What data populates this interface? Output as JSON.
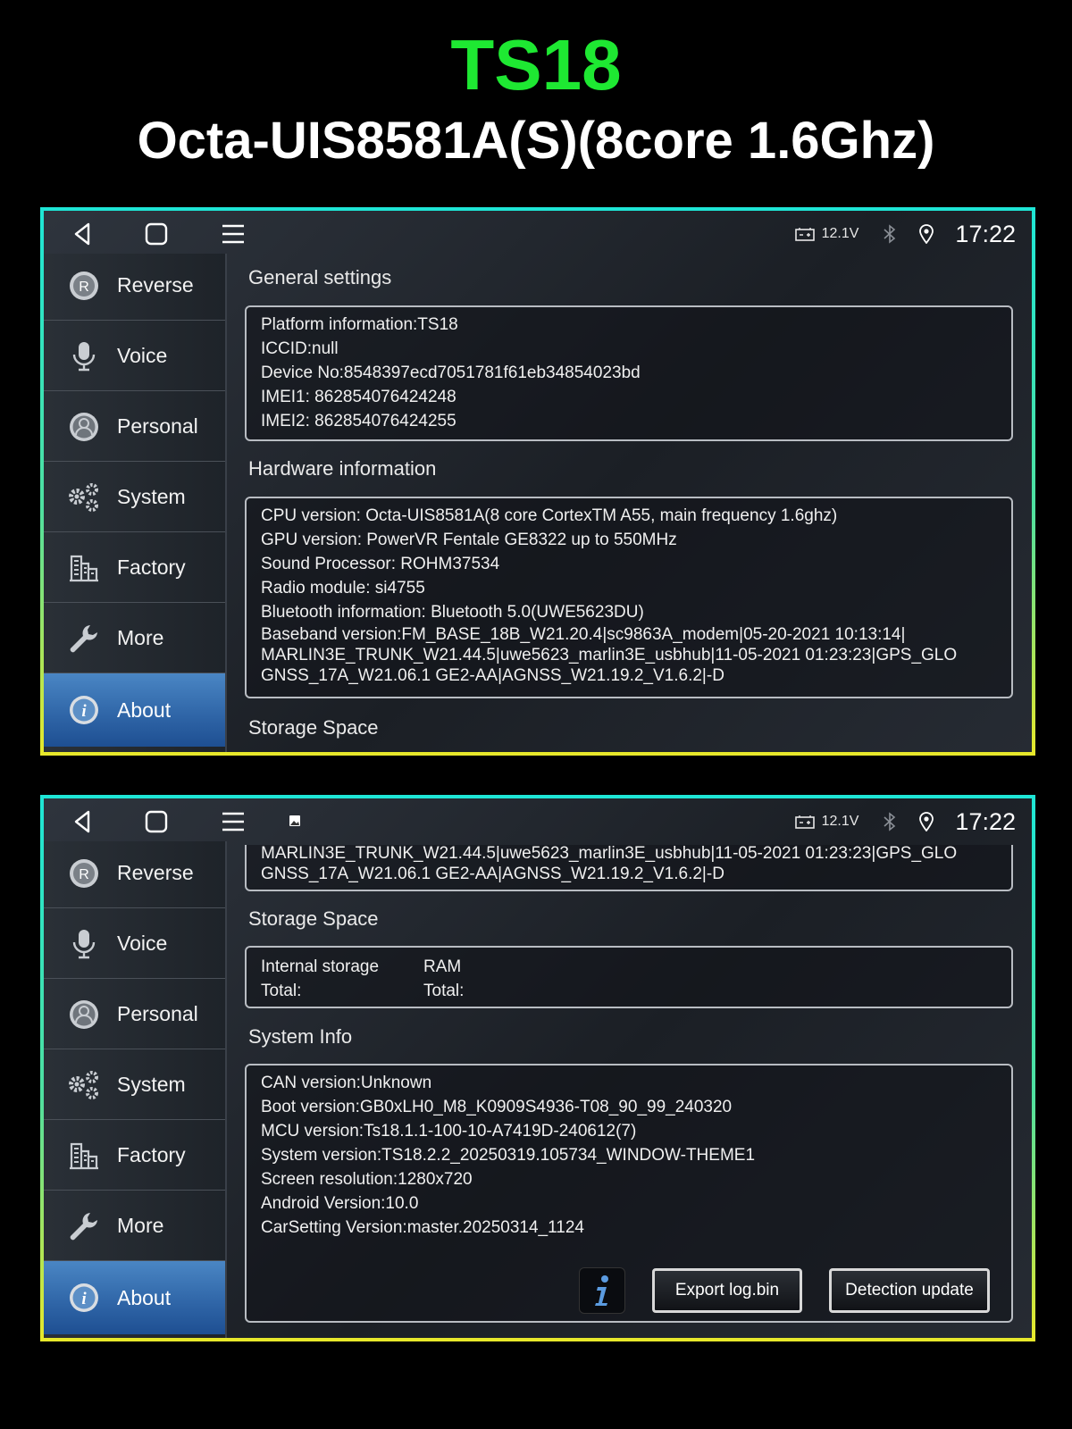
{
  "heading": {
    "model": "TS18",
    "chip": "Octa-UIS8581A(S)(8core 1.6Ghz)"
  },
  "status": {
    "voltage": "12.1V",
    "time": "17:22"
  },
  "sidebar": {
    "items": [
      {
        "label": "Reverse",
        "icon": "reverse-icon"
      },
      {
        "label": "Voice",
        "icon": "microphone-icon"
      },
      {
        "label": "Personal",
        "icon": "person-icon"
      },
      {
        "label": "System",
        "icon": "gears-icon"
      },
      {
        "label": "Factory",
        "icon": "factory-icon"
      },
      {
        "label": "More",
        "icon": "wrench-icon"
      },
      {
        "label": "About",
        "icon": "info-icon",
        "active": true
      }
    ]
  },
  "screen1": {
    "general_title": "General settings",
    "general_lines": [
      "Platform information:TS18",
      "ICCID:null",
      "Device No:8548397ecd7051781f61eb34854023bd",
      "IMEI1:  862854076424248",
      "IMEI2:  862854076424255"
    ],
    "hardware_title": "Hardware information",
    "hardware_lines": [
      "CPU version: Octa-UIS8581A(8 core CortexTM A55, main frequency 1.6ghz)",
      "GPU version: PowerVR Fentale GE8322 up to 550MHz",
      "Sound Processor: ROHM37534",
      "Radio module: si4755",
      "Bluetooth information: Bluetooth 5.0(UWE5623DU)"
    ],
    "baseband_lines": [
      "Baseband version:FM_BASE_18B_W21.20.4|sc9863A_modem|05-20-2021 10:13:14|",
      "MARLIN3E_TRUNK_W21.44.5|uwe5623_marlin3E_usbhub|11-05-2021 01:23:23|GPS_GLO",
      "GNSS_17A_W21.06.1 GE2-AA|AGNSS_W21.19.2_V1.6.2|-D"
    ],
    "storage_title": "Storage Space"
  },
  "screen2": {
    "baseband_tail": [
      "MARLIN3E_TRUNK_W21.44.5|uwe5623_marlin3E_usbhub|11-05-2021 01:23:23|GPS_GLO",
      "GNSS_17A_W21.06.1 GE2-AA|AGNSS_W21.19.2_V1.6.2|-D"
    ],
    "storage_title": "Storage Space",
    "internal_label": "Internal storage",
    "internal_total": "Total:",
    "ram_label": "RAM",
    "ram_total": "Total:",
    "sysinfo_title": "System Info",
    "sysinfo_lines": [
      "CAN version:Unknown",
      "Boot version:GB0xLH0_M8_K0909S4936-T08_90_99_240320",
      "MCU version:Ts18.1.1-100-10-A7419D-240612(7)",
      "System version:TS18.2.2_20250319.105734_WINDOW-THEME1",
      "Screen resolution:1280x720",
      "Android Version:10.0",
      "CarSetting Version:master.20250314_1124"
    ],
    "export_label": "Export log.bin",
    "detect_label": "Detection update"
  }
}
